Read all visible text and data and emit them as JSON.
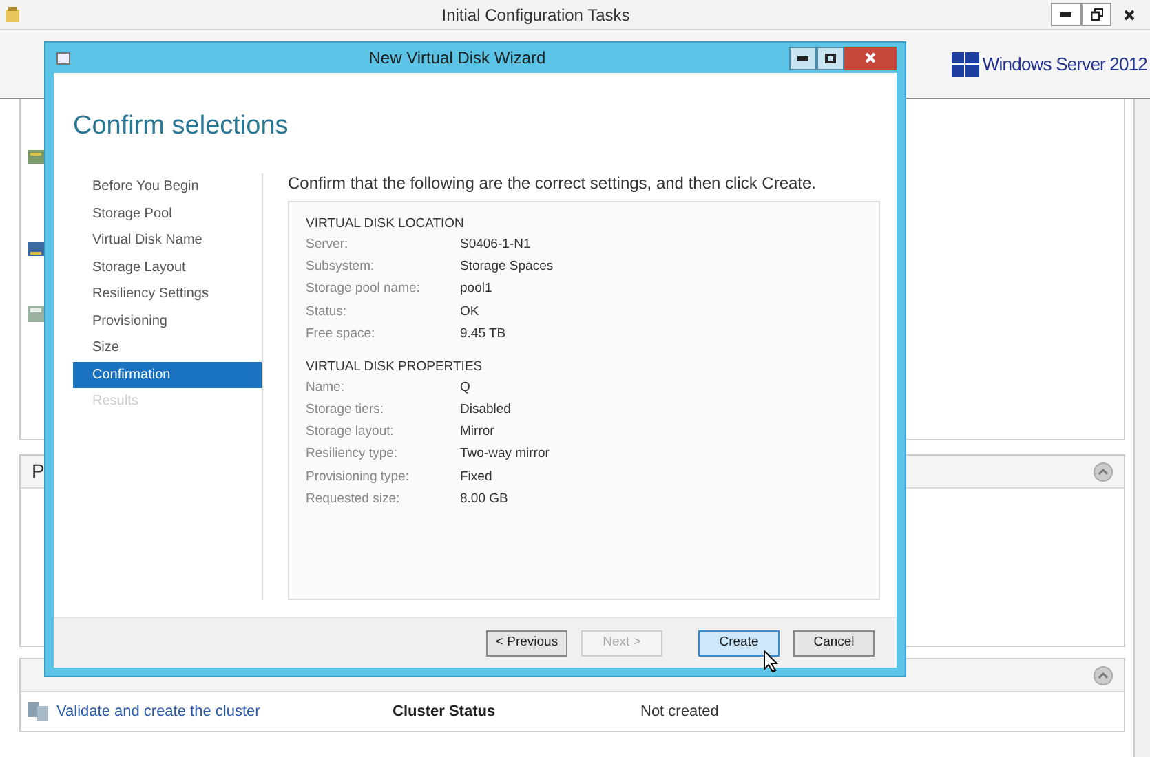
{
  "app_window": {
    "title": "Initial Configuration Tasks",
    "brand": "Windows Server 2012",
    "sections": [
      {
        "heading": "P"
      },
      {
        "rows": [
          {
            "link": "Validate and create the cluster",
            "label": "Cluster Status",
            "value": "Not created"
          }
        ]
      }
    ]
  },
  "wizard": {
    "title": "New Virtual Disk Wizard",
    "heading": "Confirm selections",
    "steps": [
      {
        "label": "Before You Begin",
        "selected": false,
        "disabled": false
      },
      {
        "label": "Storage Pool",
        "selected": false,
        "disabled": false
      },
      {
        "label": "Virtual Disk Name",
        "selected": false,
        "disabled": false
      },
      {
        "label": "Storage Layout",
        "selected": false,
        "disabled": false
      },
      {
        "label": "Resiliency Settings",
        "selected": false,
        "disabled": false
      },
      {
        "label": "Provisioning",
        "selected": false,
        "disabled": false
      },
      {
        "label": "Size",
        "selected": false,
        "disabled": false
      },
      {
        "label": "Confirmation",
        "selected": true,
        "disabled": false
      },
      {
        "label": "Results",
        "selected": false,
        "disabled": true
      }
    ],
    "intro": "Confirm that the following are the correct settings, and then click Create.",
    "groups": [
      {
        "heading": "VIRTUAL DISK LOCATION",
        "rows": [
          {
            "label": "Server:",
            "value": "S0406-1-N1"
          },
          {
            "label": "Subsystem:",
            "value": "Storage Spaces"
          },
          {
            "label": "Storage pool name:",
            "value": "pool1"
          },
          {
            "label": "Status:",
            "value": "OK"
          },
          {
            "label": "Free space:",
            "value": "9.45 TB"
          }
        ]
      },
      {
        "heading": "VIRTUAL DISK PROPERTIES",
        "rows": [
          {
            "label": "Name:",
            "value": "Q"
          },
          {
            "label": "Storage tiers:",
            "value": "Disabled"
          },
          {
            "label": "Storage layout:",
            "value": "Mirror"
          },
          {
            "label": "Resiliency type:",
            "value": "Two-way mirror"
          },
          {
            "label": "Provisioning type:",
            "value": "Fixed"
          },
          {
            "label": "Requested size:",
            "value": "8.00 GB"
          }
        ]
      }
    ],
    "buttons": [
      {
        "label": "< Previous",
        "disabled": false,
        "selected": false
      },
      {
        "label": "Next >",
        "disabled": true,
        "selected": false
      },
      {
        "label": "Create",
        "disabled": false,
        "selected": true
      },
      {
        "label": "Cancel",
        "disabled": false,
        "selected": false
      }
    ]
  }
}
